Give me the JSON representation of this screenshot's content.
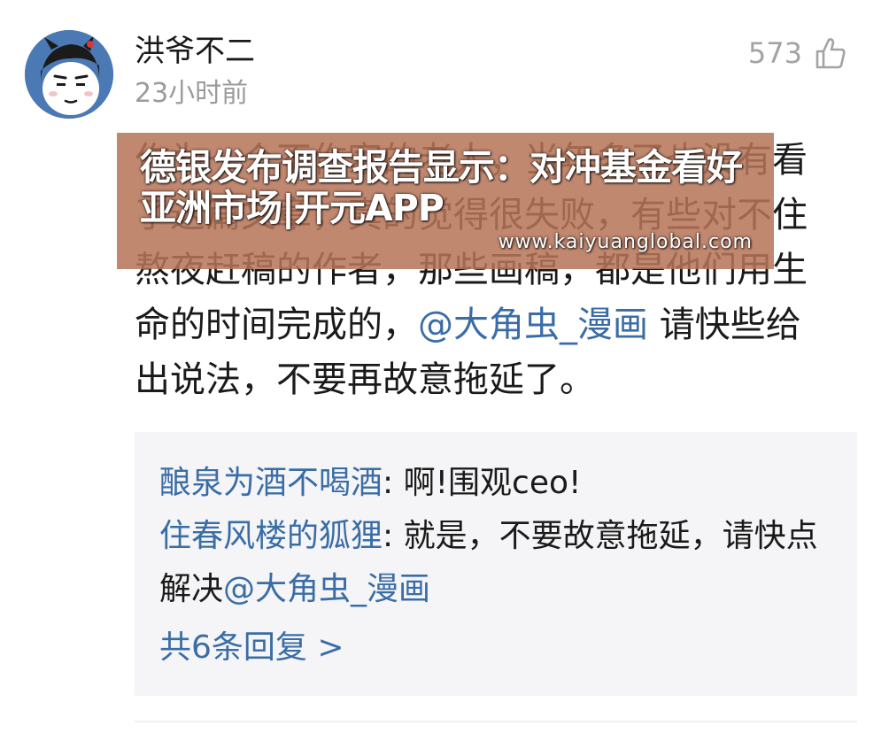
{
  "comment": {
    "author": "洪爷不二",
    "time": "23小时前",
    "likes": "573",
    "text_parts": [
      "作为一个不作家的老人，当年多了也没有看了这篇文章，真的觉得很失败，有些对不住熬夜赶稿的作者，那些画稿，都是他们用生命的时间完成的，",
      "@大角虫_漫画",
      " 请快些给出说法，不要再故意拖延了。"
    ]
  },
  "replies": [
    {
      "user": "酿泉为酒不喝酒",
      "text": ": 啊!围观ceo!"
    },
    {
      "user": "住春风楼的狐狸",
      "text": ": 就是，不要故意拖延，请快点解决",
      "mention": "@大角虫_漫画"
    }
  ],
  "more_replies": "共6条回复 >",
  "overlay": {
    "title": "德银发布调查报告显示：对冲基金看好亚洲市场|开元APP",
    "url": "www.kaiyuanglobal.com"
  },
  "colors": {
    "link": "#3a6da6",
    "muted": "#9b9b9b",
    "reply_bg": "#f5f5f7",
    "overlay_bg": "#b77458"
  },
  "icons": {
    "like": "thumbs-up-icon",
    "avatar": "cartoon-avatar"
  }
}
